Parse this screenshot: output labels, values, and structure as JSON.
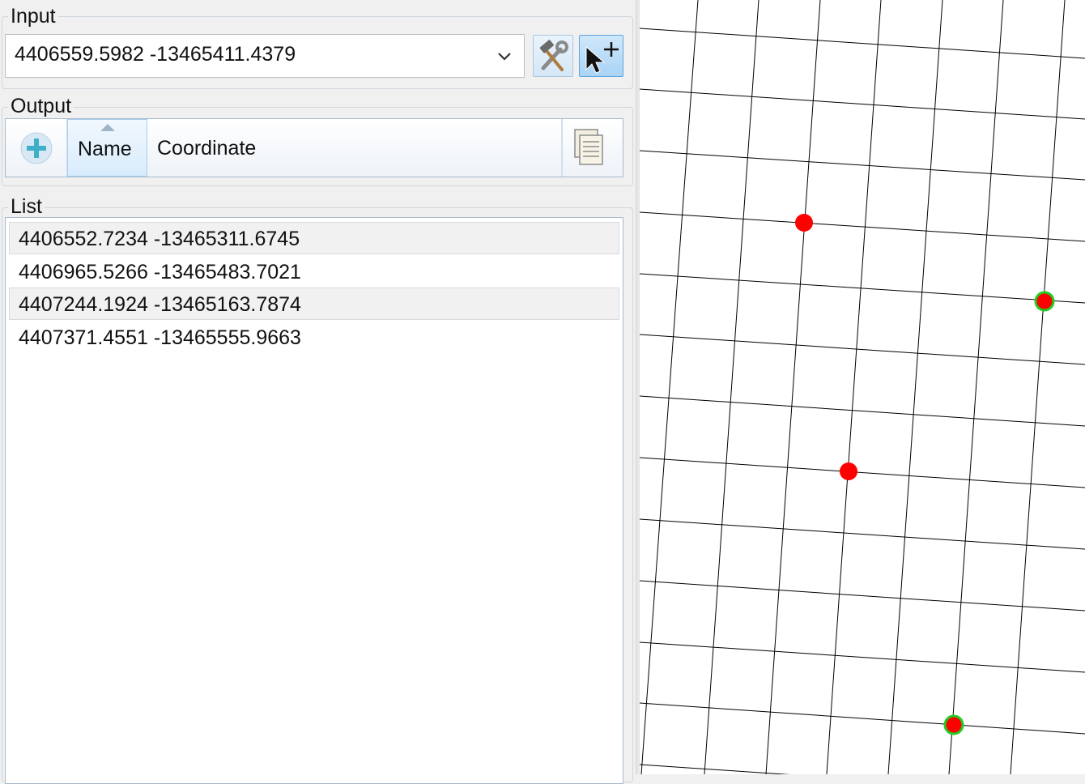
{
  "input": {
    "label": "Input",
    "value": "4406559.5982 -13465411.4379",
    "tools_icon": "hammer-wrench-icon",
    "add_point_icon": "cursor-plus-icon"
  },
  "output": {
    "label": "Output",
    "add_icon": "plus-circle-icon",
    "columns": [
      "Name",
      "Coordinate"
    ],
    "copy_icon": "copy-all-icon"
  },
  "list": {
    "label": "List",
    "items": [
      "4406552.7234 -13465311.6745",
      "4406965.5266 -13465483.7021",
      "4407244.1924 -13465163.7874",
      "4407371.4551 -13465555.9663"
    ]
  },
  "map": {
    "point_color": "#ff0000",
    "highlight_ring_color": "#22cc22"
  }
}
